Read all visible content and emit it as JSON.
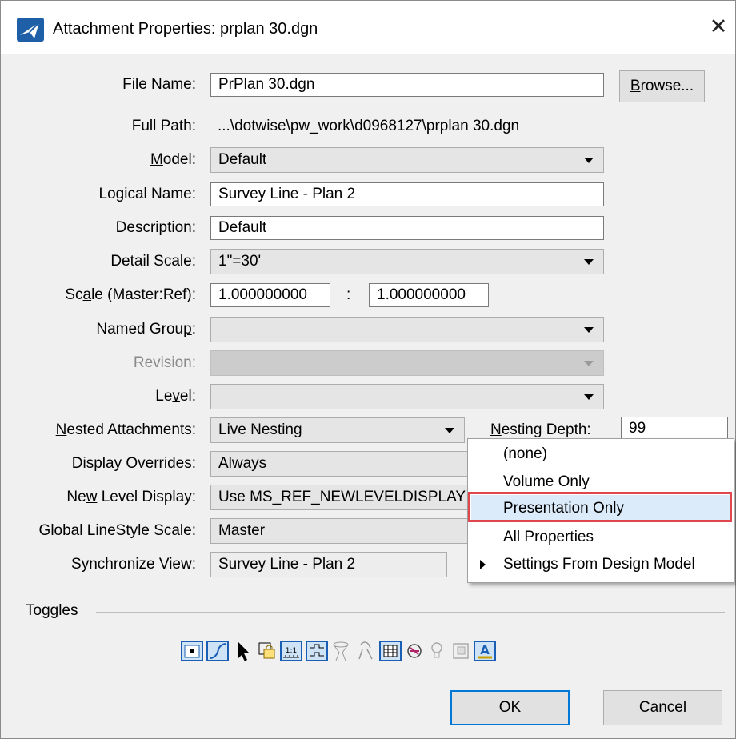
{
  "window": {
    "title": "Attachment Properties: prplan 30.dgn",
    "close_glyph": "✕"
  },
  "form": {
    "file_name": {
      "label": "File Name:",
      "value": "PrPlan 30.dgn"
    },
    "browse_label": "Browse...",
    "full_path": {
      "label": "Full Path:",
      "value": "...\\dotwise\\pw_work\\d0968127\\prplan 30.dgn"
    },
    "model": {
      "label": "Model:",
      "value": "Default"
    },
    "logical_name": {
      "label": "Logical Name:",
      "value": "Survey Line - Plan 2"
    },
    "description": {
      "label": "Description:",
      "value": "Default"
    },
    "detail_scale": {
      "label": "Detail Scale:",
      "value": "1\"=30'"
    },
    "scale": {
      "label": "Scale (Master:Ref):",
      "master": "1.000000000",
      "separator": ":",
      "ref": "1.000000000"
    },
    "named_group": {
      "label": "Named Group:",
      "value": ""
    },
    "revision": {
      "label": "Revision:",
      "value": ""
    },
    "level": {
      "label": "Level:",
      "value": ""
    },
    "nested_attachments": {
      "label": "Nested Attachments:",
      "value": "Live Nesting"
    },
    "nesting_depth": {
      "label": "Nesting Depth:",
      "value": "99"
    },
    "display_overrides": {
      "label": "Display Overrides:",
      "value": "Always"
    },
    "new_level_display": {
      "label": "New Level Display:",
      "value": "Use MS_REF_NEWLEVELDISPLAY"
    },
    "global_linestyle_scale": {
      "label": "Global LineStyle Scale:",
      "value": "Master"
    },
    "synchronize_view": {
      "label": "Synchronize View:",
      "value": "Survey Line - Plan 2"
    }
  },
  "dropdown_menu": {
    "items": [
      {
        "label": "(none)"
      },
      {
        "label": "Volume Only"
      },
      {
        "label": "Presentation Only",
        "highlighted": true
      },
      {
        "label": "All Properties"
      },
      {
        "label": "Settings From Design Model",
        "submenu": true
      }
    ],
    "highlight_color": "#e0464b"
  },
  "toggles": {
    "label": "Toggles",
    "icons": [
      "display-toggle-icon",
      "snap-toggle-icon",
      "locate-toggle-icon",
      "ignore-attachment-when-live-nesting-icon",
      "true-scale-icon",
      "scale-line-styles-icon",
      "use-lights-icon",
      "clip-back-icon",
      "treat-as-element-icon",
      "hide-icon",
      "use-light-bulb-icon",
      "georeferenced-icon",
      "annotation-scale-icon"
    ]
  },
  "buttons": {
    "ok": "OK",
    "cancel": "Cancel"
  },
  "colors": {
    "accent": "#0078d7",
    "menu_highlight": "#dcebfa"
  }
}
